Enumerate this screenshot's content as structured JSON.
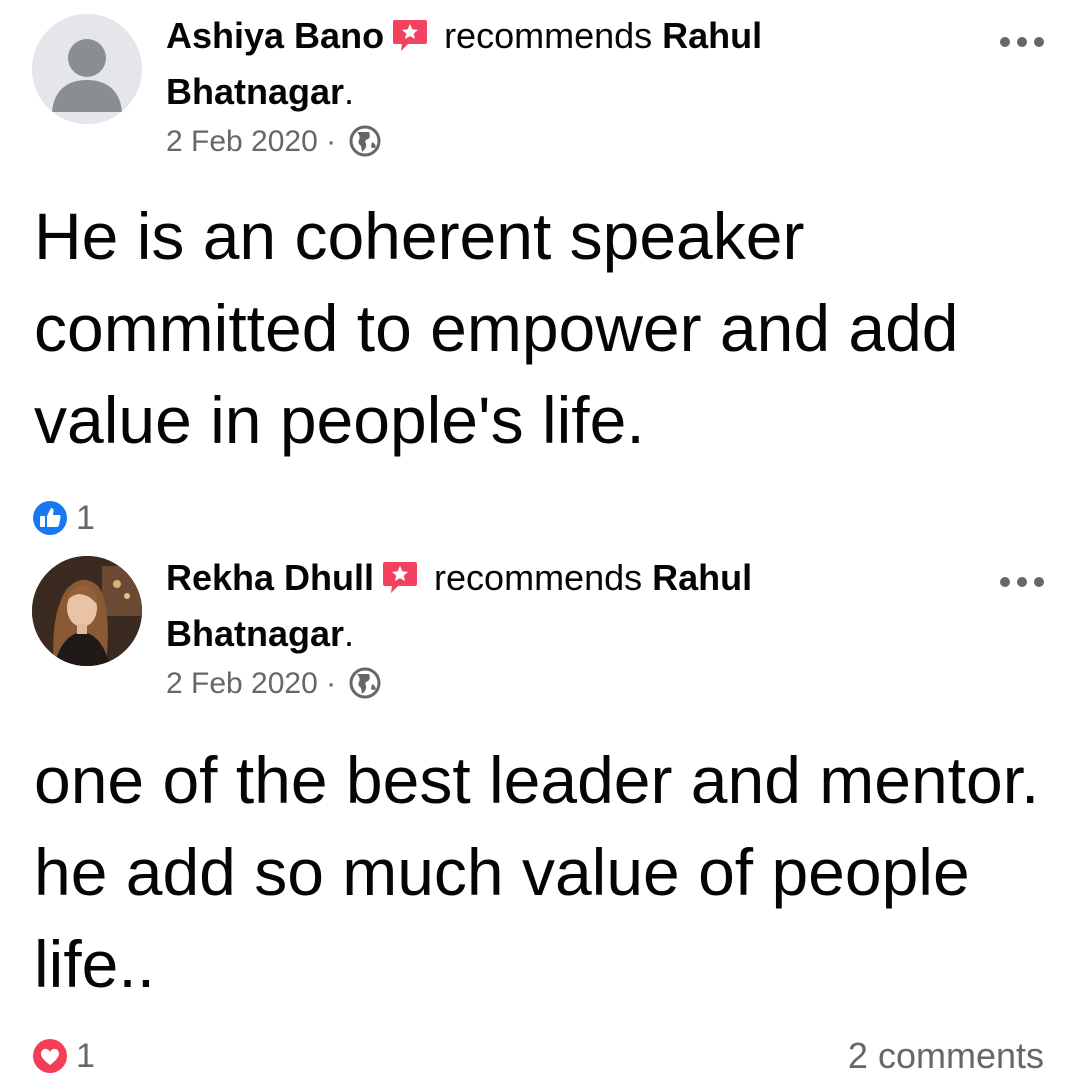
{
  "posts": [
    {
      "author": "Ashiya Bano",
      "action": "recommends",
      "target_line1": "Rahul",
      "target_line2": "Bhatnagar",
      "period": ".",
      "date": "2 Feb 2020",
      "separator": "·",
      "privacy_icon": "globe-icon",
      "text": "He is an coherent speaker committed to empower and add value in people's life.",
      "reaction": {
        "type": "like",
        "icon": "thumbs-up-icon",
        "count": "1",
        "color": "#1877f2"
      },
      "comments": ""
    },
    {
      "author": "Rekha Dhull",
      "action": "recommends",
      "target_line1": "Rahul",
      "target_line2": "Bhatnagar",
      "period": ".",
      "date": "2 Feb 2020",
      "separator": "·",
      "privacy_icon": "globe-icon",
      "text": "one of the best leader and mentor. he add so much value of people life..",
      "reaction": {
        "type": "love",
        "icon": "heart-icon",
        "count": "1",
        "color": "#f33e58"
      },
      "comments": "2 comments"
    }
  ],
  "colors": {
    "secondary_text": "#65676b",
    "recommend_badge": "#f3425f",
    "like_blue": "#1877f2",
    "love_red": "#f33e58"
  }
}
